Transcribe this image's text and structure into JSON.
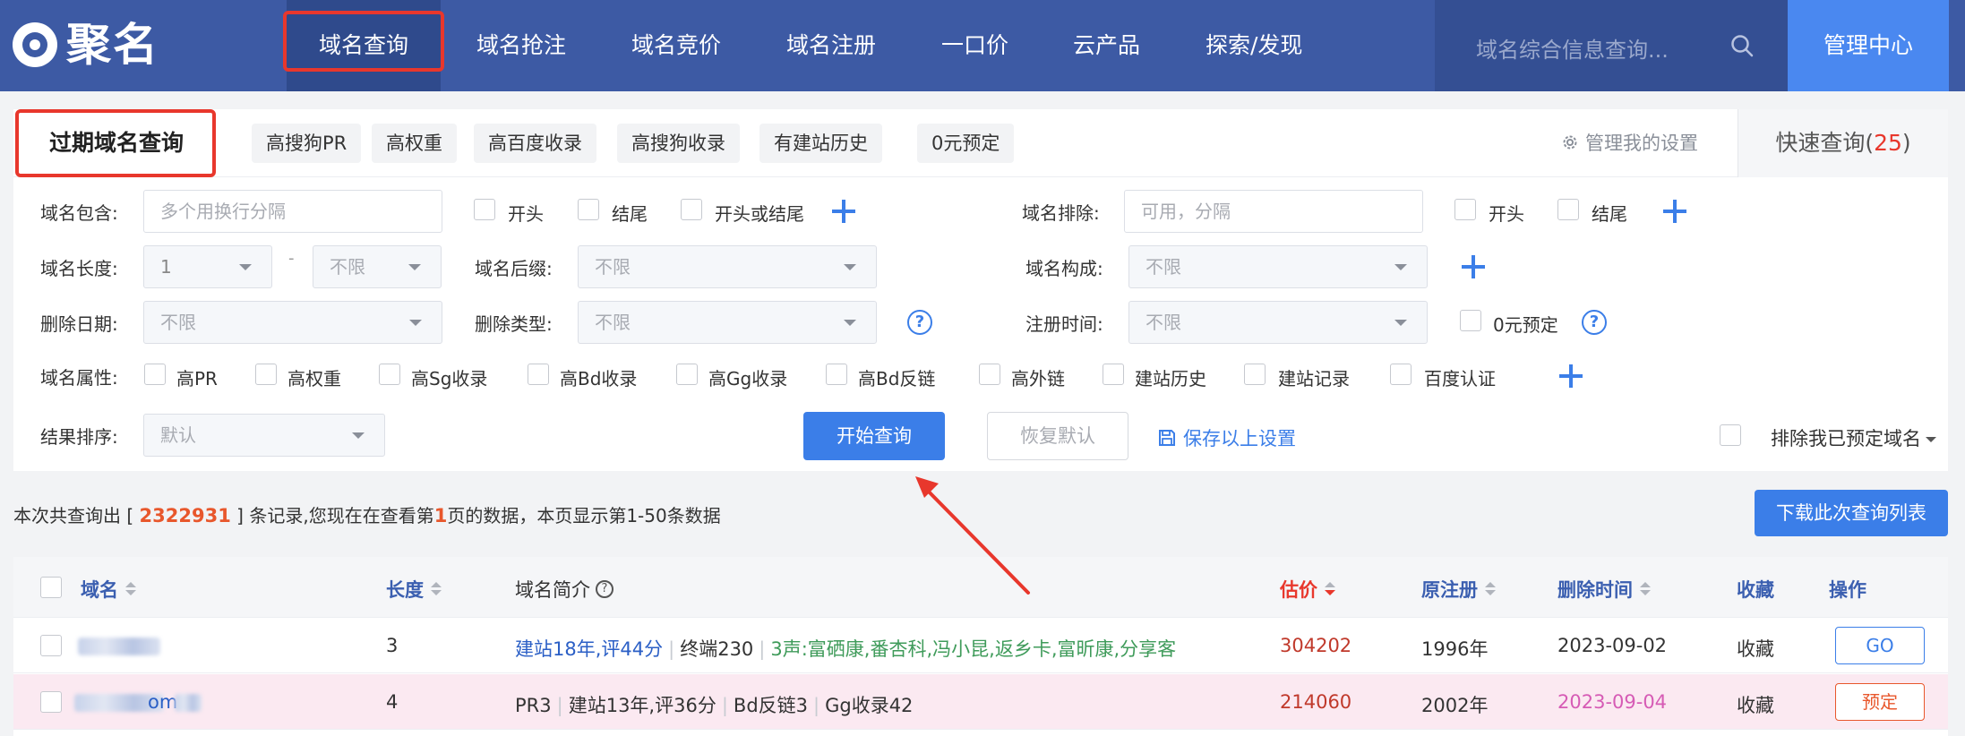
{
  "nav": {
    "logo_text": "聚名",
    "items": [
      "域名查询",
      "域名抢注",
      "域名竞价",
      "域名注册",
      "一口价",
      "云产品",
      "探索/发现"
    ],
    "search_placeholder": "域名综合信息查询...",
    "admin_label": "管理中心"
  },
  "tabs": {
    "main": "过期域名查询",
    "chips": [
      "高搜狗PR",
      "高权重",
      "高百度收录",
      "高搜狗收录",
      "有建站历史",
      "0元预定"
    ],
    "manage_settings": "管理我的设置",
    "quick_label": "快速查询(",
    "quick_count": "25",
    "quick_close": ")"
  },
  "filters": {
    "contains_label": "域名包含:",
    "contains_placeholder": "多个用换行分隔",
    "cb_start": "开头",
    "cb_end": "结尾",
    "cb_start_or_end": "开头或结尾",
    "exclude_label": "域名排除:",
    "exclude_placeholder": "可用，分隔",
    "length_label": "域名长度:",
    "length_min": "1",
    "length_max": "不限",
    "length_dash": "-",
    "suffix_label": "域名后缀:",
    "suffix_value": "不限",
    "compose_label": "域名构成:",
    "compose_value": "不限",
    "delete_date_label": "删除日期:",
    "delete_date_value": "不限",
    "delete_type_label": "删除类型:",
    "delete_type_value": "不限",
    "reg_time_label": "注册时间:",
    "reg_time_value": "不限",
    "zero_book": "0元预定",
    "attr_label": "域名属性:",
    "attrs": [
      "高PR",
      "高权重",
      "高Sg收录",
      "高Bd收录",
      "高Gg收录",
      "高Bd反链",
      "高外链",
      "建站历史",
      "建站记录",
      "百度认证"
    ],
    "sort_label": "结果排序:",
    "sort_value": "默认",
    "start_btn": "开始查询",
    "reset_btn": "恢复默认",
    "save_settings": "保存以上设置",
    "exclude_booked": "排除我已预定域名"
  },
  "summary": {
    "prefix": "本次共查询出 [ ",
    "total": "2322931",
    "middle": " ] 条记录,您现在在查看第",
    "page": "1",
    "suffix": "页的数据，本页显示第1-50条数据",
    "download_btn": "下载此次查询列表"
  },
  "table": {
    "headers": {
      "domain": "域名",
      "length": "长度",
      "intro": "域名简介",
      "price": "估价",
      "orig_reg": "原注册",
      "delete_time": "删除时间",
      "favorite": "收藏",
      "action": "操作"
    },
    "rows": [
      {
        "length": "3",
        "intro_a": "建站18年,评44分",
        "intro_b": "终端230",
        "intro_c": "3声:富硒康,番杏科,冯小昆,返乡卡,富昕康,分享客",
        "price": "304202",
        "orig_reg": "1996年",
        "delete_time": "2023-09-02",
        "favorite": "收藏",
        "action": "GO"
      },
      {
        "length": "4",
        "intro_a": "PR3",
        "intro_b": "建站13年,评36分",
        "intro_c": "Bd反链3",
        "intro_d": "Gg收录42",
        "price": "214060",
        "orig_reg": "2002年",
        "delete_time": "2023-09-04",
        "favorite": "收藏",
        "action": "预定"
      }
    ],
    "row2_domain_fragment": "om"
  },
  "colors": {
    "nav_bg": "#3d5aa4",
    "accent": "#3b7ee8",
    "highlight": "#e8372c"
  }
}
